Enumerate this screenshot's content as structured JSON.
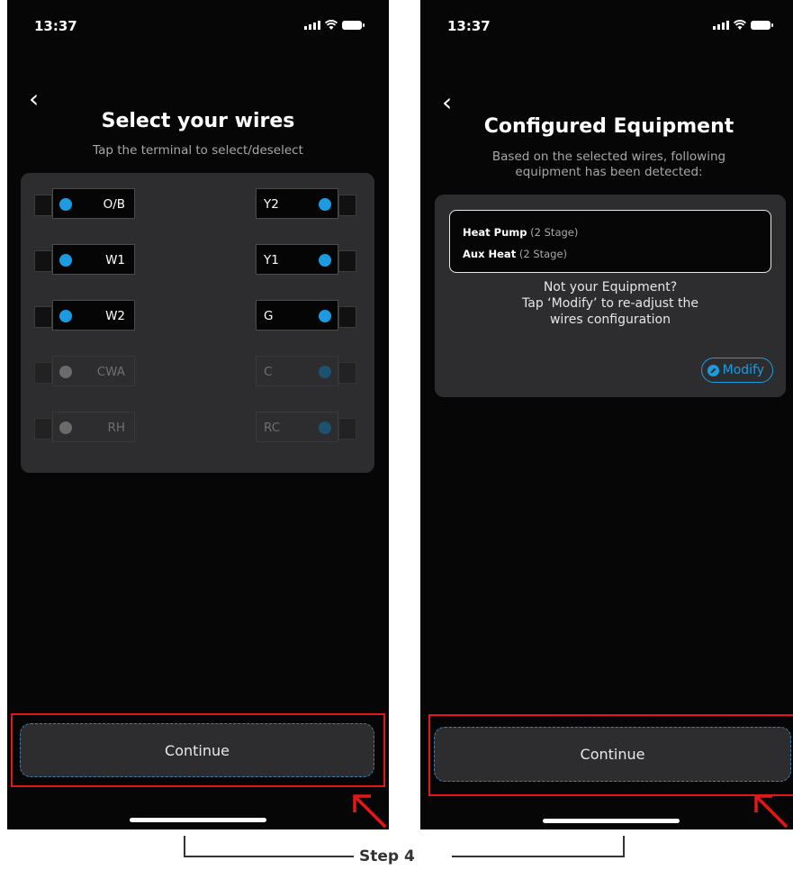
{
  "screen1": {
    "time": "13:37",
    "back_glyph": "‹",
    "title": "Select your wires",
    "subtitle": "Tap the terminal to select/deselect",
    "terminals_left": [
      {
        "label": "O/B",
        "selected": true
      },
      {
        "label": "W1",
        "selected": true
      },
      {
        "label": "W2",
        "selected": true
      },
      {
        "label": "CWA",
        "selected": false
      },
      {
        "label": "RH",
        "selected": false
      }
    ],
    "terminals_right": [
      {
        "label": "Y2",
        "selected": true
      },
      {
        "label": "Y1",
        "selected": true
      },
      {
        "label": "G",
        "selected": true
      },
      {
        "label": "C",
        "selected": false
      },
      {
        "label": "RC",
        "selected": false
      }
    ],
    "continue_label": "Continue"
  },
  "screen2": {
    "time": "13:37",
    "back_glyph": "‹",
    "title": "Configured Equipment",
    "subtitle_line1": "Based on the selected wires, following",
    "subtitle_line2": "equipment has been detected:",
    "equipment": [
      {
        "name": "Heat Pump",
        "detail": "(2 Stage)"
      },
      {
        "name": "Aux Heat",
        "detail": "(2 Stage)"
      }
    ],
    "note_line1": "Not your Equipment?",
    "note_line2": "Tap ‘Modify’ to re-adjust the",
    "note_line3": "wires configuration",
    "modify_label": "Modify",
    "continue_label": "Continue"
  },
  "step_label": "Step 4",
  "colors": {
    "accent": "#1c9be0",
    "highlight_red": "#e01818",
    "panel": "#2d2d30",
    "screen_bg": "#060606"
  },
  "icons": [
    "back-chevron-icon",
    "signal-icon",
    "wifi-icon",
    "battery-icon",
    "edit-pencil-icon",
    "red-arrow-icon"
  ]
}
